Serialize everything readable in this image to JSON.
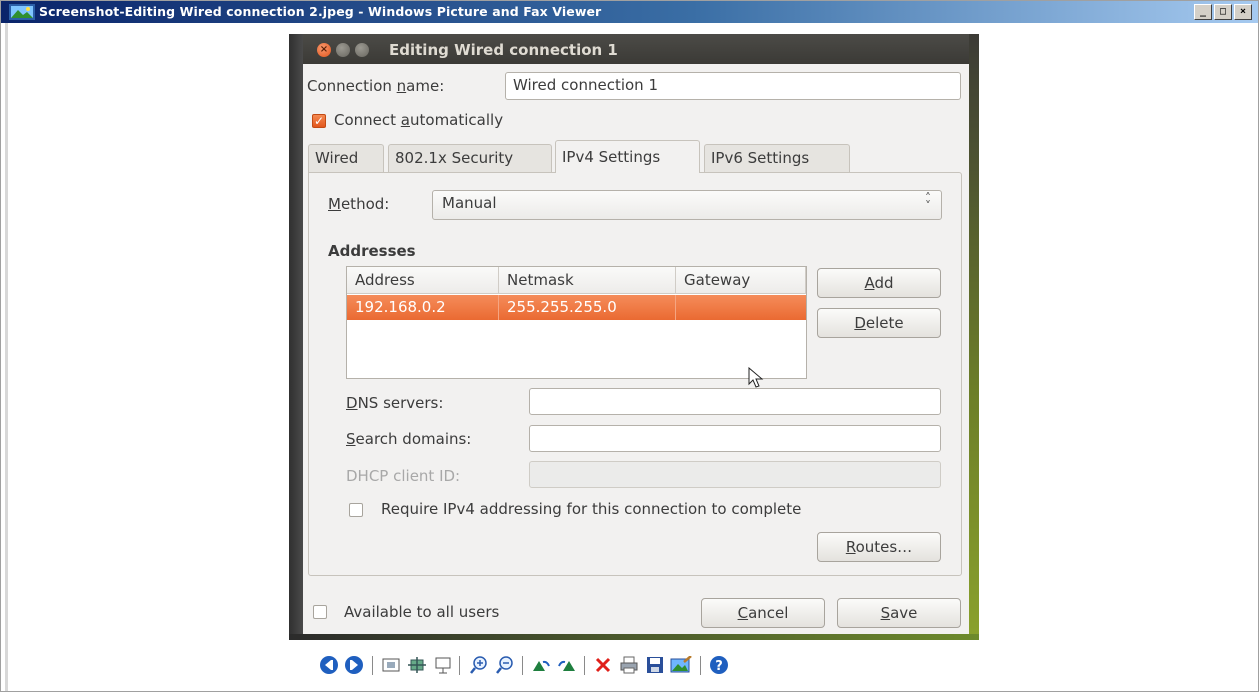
{
  "window": {
    "title": "Screenshot-Editing Wired connection 2.jpeg - Windows Picture and Fax Viewer",
    "controls": [
      "_",
      "□",
      "×"
    ]
  },
  "dialog": {
    "title": "Editing Wired connection 1",
    "connection_name_label_pre": "Connection ",
    "connection_name_label_u": "n",
    "connection_name_label_post": "ame:",
    "connection_name_value": "Wired connection 1",
    "connect_auto_pre": "Connect ",
    "connect_auto_u": "a",
    "connect_auto_post": "utomatically",
    "connect_auto_checked": true,
    "tabs": [
      "Wired",
      "802.1x Security",
      "IPv4 Settings",
      "IPv6 Settings"
    ],
    "active_tab": "IPv4 Settings",
    "method_label_u": "M",
    "method_label_post": "ethod:",
    "method_value": "Manual",
    "addresses_heading": "Addresses",
    "columns": [
      "Address",
      "Netmask",
      "Gateway"
    ],
    "rows": [
      {
        "address": "192.168.0.2",
        "netmask": "255.255.255.0",
        "gateway": ""
      }
    ],
    "add_u": "A",
    "add_post": "dd",
    "delete_u": "D",
    "delete_post": "elete",
    "dns_u": "D",
    "dns_post": "NS servers:",
    "dns_value": "",
    "search_u": "S",
    "search_post": "earch domains:",
    "search_value": "",
    "dhcp_label": "DHCP client ID:",
    "dhcp_value": "",
    "require_ipv4_label": "Require IPv4 addressing for this connection to complete",
    "require_ipv4_checked": false,
    "routes_u": "R",
    "routes_post": "outes…",
    "available_all_users": "Available to all users",
    "available_checked": false,
    "cancel_u": "C",
    "cancel_post": "ancel",
    "save_u": "S",
    "save_post": "ave"
  },
  "toolbar": {
    "items": [
      "previous-image-icon",
      "next-image-icon",
      "best-fit-icon",
      "actual-size-icon",
      "slideshow-icon",
      "zoom-in-icon",
      "zoom-out-icon",
      "rotate-clockwise-icon",
      "rotate-counterclockwise-icon",
      "delete-icon",
      "print-icon",
      "save-icon",
      "edit-icon",
      "help-icon"
    ]
  },
  "colors": {
    "title_bar_start": "#0a246a",
    "accent_orange": "#ea6a32",
    "dialog_bg": "#f2f1f0"
  }
}
